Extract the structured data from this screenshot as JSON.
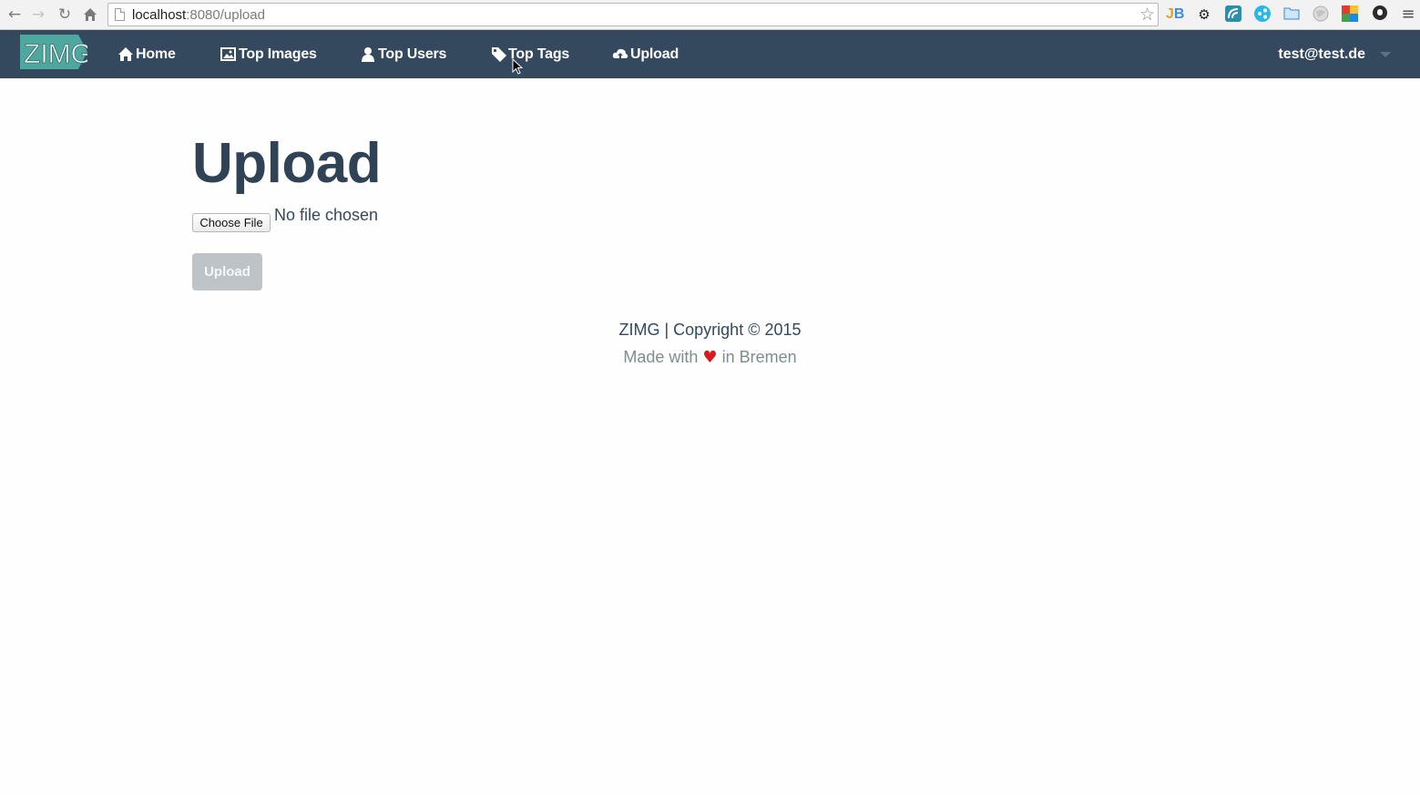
{
  "browser": {
    "url_host": "localhost",
    "url_path": ":8080/upload",
    "icons": [
      "back-icon",
      "forward-icon",
      "reload-icon",
      "home-icon",
      "page-icon",
      "bookmark-star-icon",
      "jetbrains-icon",
      "gear-icon",
      "extension-icon",
      "share-icon",
      "folder-icon",
      "globe-icon",
      "grid-icon",
      "ghost-icon",
      "menu-icon"
    ]
  },
  "navbar": {
    "brand": "ZIMG",
    "items": [
      {
        "label": "Home",
        "icon": "home-icon"
      },
      {
        "label": "Top Images",
        "icon": "image-icon"
      },
      {
        "label": "Top Users",
        "icon": "user-icon"
      },
      {
        "label": "Top Tags",
        "icon": "tags-icon"
      },
      {
        "label": "Upload",
        "icon": "cloud-upload-icon"
      }
    ],
    "user": "test@test.de"
  },
  "main": {
    "title": "Upload",
    "choose_file_label": "Choose File",
    "file_status": "No file chosen",
    "upload_button": "Upload"
  },
  "footer": {
    "line1": "ZIMG | Copyright © 2015",
    "made_with": "Made with",
    "heart": "♥",
    "location": "in Bremen"
  },
  "colors": {
    "navbar": "#34495e",
    "accent": "#4ea8a0",
    "disabled_button": "#bdc3c7",
    "heart": "#d91a1a"
  }
}
